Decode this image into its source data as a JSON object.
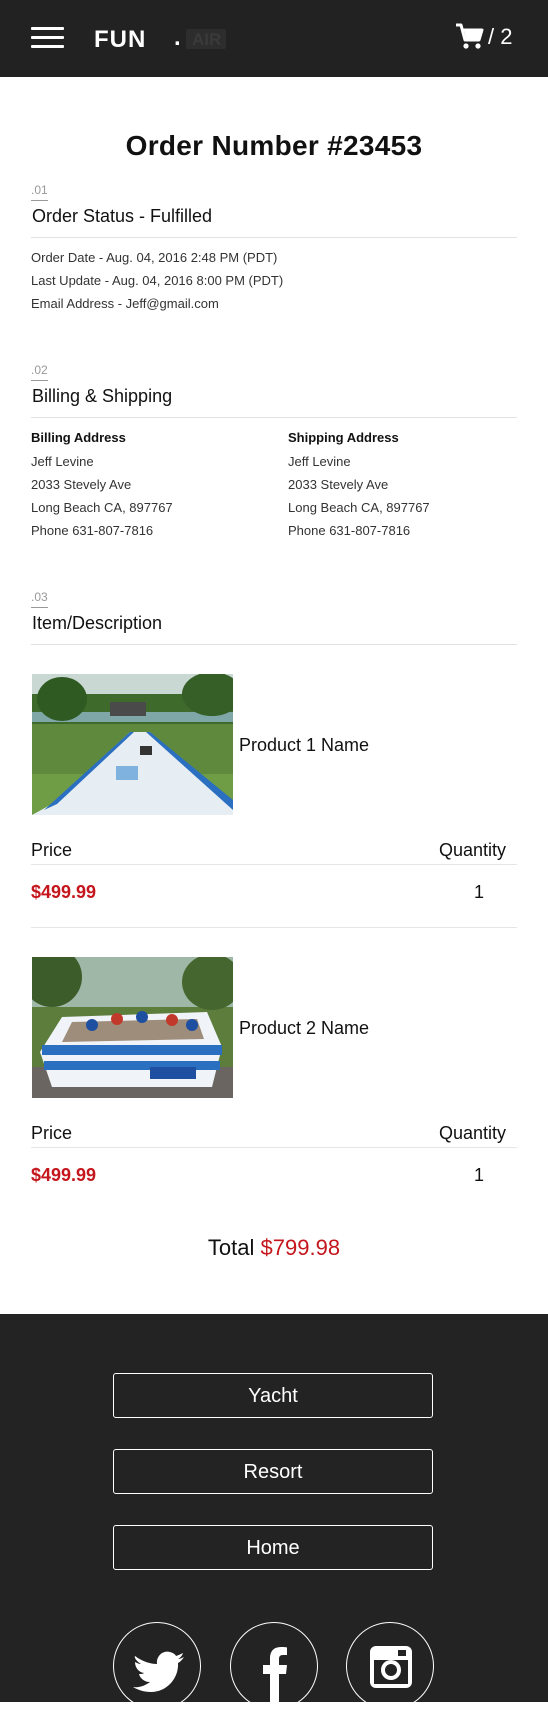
{
  "header": {
    "logo_text": "FUN",
    "logo_dot": ".",
    "logo_suffix": "AIR",
    "cart_count": "/ 2"
  },
  "page_title": "Order Number #23453",
  "sections": {
    "status": {
      "num": ".01",
      "title": "Order Status - Fulfilled",
      "lines": [
        "Order Date - Aug. 04, 2016 2:48 PM (PDT)",
        "Last Update - Aug. 04, 2016 8:00 PM (PDT)",
        "Email Address - Jeff@gmail.com"
      ]
    },
    "billing": {
      "num": ".02",
      "title": "Billing & Shipping",
      "billing_head": "Billing Address",
      "billing_lines": [
        "Jeff Levine",
        "2033 Stevely Ave",
        "Long Beach CA, 897767",
        "Phone 631-807-7816"
      ],
      "shipping_head": "Shipping Address",
      "shipping_lines": [
        "Jeff Levine",
        "2033 Stevely Ave",
        "Long Beach CA, 897767",
        "Phone 631-807-7816"
      ]
    },
    "items": {
      "num": ".03",
      "title": "Item/Description",
      "price_label": "Price",
      "quantity_label": "Quantity",
      "products": [
        {
          "name": "Product 1 Name",
          "price": "$499.99",
          "quantity": "1"
        },
        {
          "name": "Product 2 Name",
          "price": "$499.99",
          "quantity": "1"
        }
      ]
    }
  },
  "total": {
    "label": "Total",
    "value": "$799.98"
  },
  "footer": {
    "buttons": [
      "Yacht",
      "Resort",
      "Home"
    ],
    "social": [
      "twitter-icon",
      "facebook-icon",
      "instagram-icon"
    ]
  },
  "colors": {
    "accent": "#c4161c",
    "header_bg": "#222222",
    "footer_bg": "#232323"
  }
}
